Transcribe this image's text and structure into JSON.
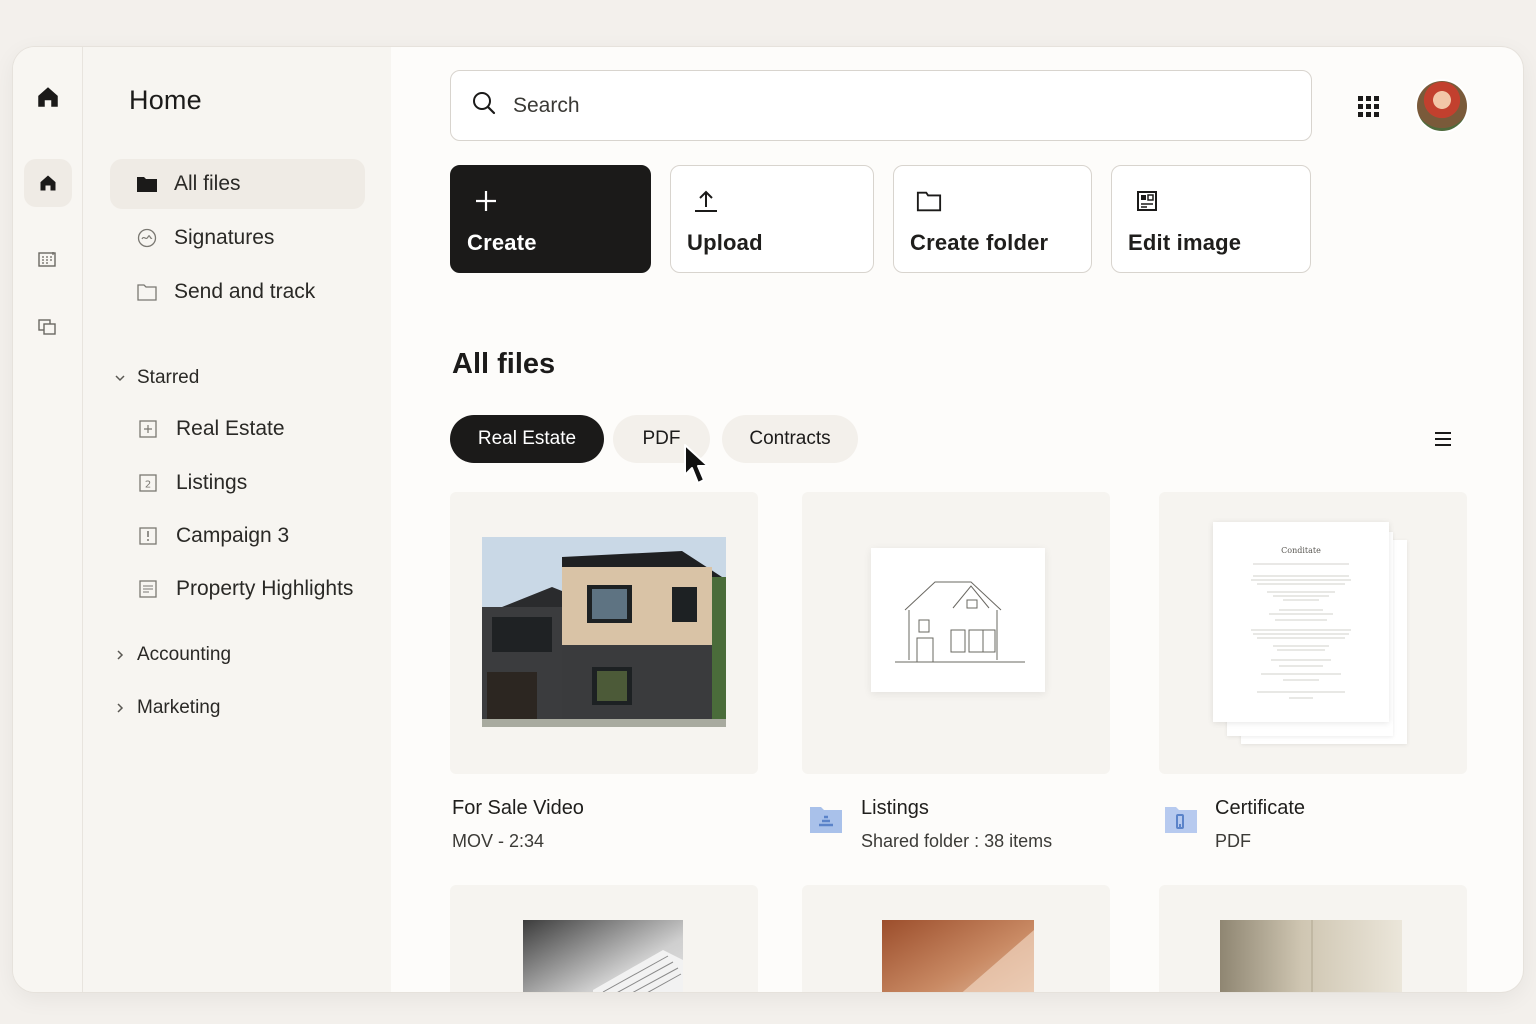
{
  "sidebar": {
    "title": "Home",
    "nav": [
      {
        "label": "All files",
        "icon": "folder-filled-icon",
        "active": true
      },
      {
        "label": "Signatures",
        "icon": "signature-icon"
      },
      {
        "label": "Send and track",
        "icon": "folder-outline-icon"
      }
    ],
    "starred": {
      "label": "Starred",
      "items": [
        {
          "label": "Real Estate",
          "icon": "image-file-icon"
        },
        {
          "label": "Listings",
          "icon": "number-file-icon"
        },
        {
          "label": "Campaign 3",
          "icon": "alert-file-icon"
        },
        {
          "label": "Property Highlights",
          "icon": "doc-file-icon"
        }
      ]
    },
    "groups": [
      {
        "label": "Accounting"
      },
      {
        "label": "Marketing"
      }
    ]
  },
  "search": {
    "placeholder": "Search"
  },
  "actions": [
    {
      "label": "Create",
      "icon": "plus-icon"
    },
    {
      "label": "Upload",
      "icon": "upload-icon"
    },
    {
      "label": "Create folder",
      "icon": "folder-icon"
    },
    {
      "label": "Edit image",
      "icon": "edit-image-icon"
    }
  ],
  "main": {
    "title": "All files",
    "filters": [
      {
        "label": "Real Estate",
        "active": true
      },
      {
        "label": "PDF"
      },
      {
        "label": "Contracts"
      }
    ],
    "files": [
      {
        "name": "For Sale Video",
        "meta": "MOV - 2:34"
      },
      {
        "name": "Listings",
        "meta": "Shared folder : 38 items"
      },
      {
        "name": "Certificate",
        "meta": "PDF"
      }
    ],
    "certificate_heading": "Conditate"
  },
  "colors": {
    "accent_dark": "#1b1a19",
    "folder_blue": "#9fb9e6",
    "background": "#f3f0ec"
  }
}
